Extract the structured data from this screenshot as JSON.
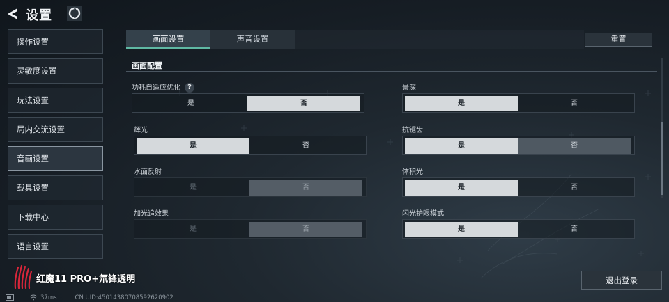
{
  "header": {
    "title": "设置",
    "back_icon": "back-arrow-icon",
    "logo_icon": "game-logo-icon"
  },
  "sidebar": {
    "items": [
      {
        "label": "操作设置",
        "active": false
      },
      {
        "label": "灵敏度设置",
        "active": false
      },
      {
        "label": "玩法设置",
        "active": false
      },
      {
        "label": "局内交流设置",
        "active": false
      },
      {
        "label": "音画设置",
        "active": true
      },
      {
        "label": "载具设置",
        "active": false
      },
      {
        "label": "下载中心",
        "active": false
      },
      {
        "label": "语言设置",
        "active": false
      }
    ]
  },
  "tabs": [
    {
      "label": "画面设置",
      "active": true
    },
    {
      "label": "声音设置",
      "active": false
    }
  ],
  "reset_label": "重置",
  "section": {
    "title": "画面配置",
    "options": [
      {
        "label": "功耗自适应优化",
        "help": "?",
        "yes": "是",
        "no": "否",
        "selected": "no",
        "disabled": false
      },
      {
        "label": "景深",
        "yes": "是",
        "no": "否",
        "selected": "yes",
        "disabled": false
      },
      {
        "label": "辉光",
        "yes": "是",
        "no": "否",
        "selected": "yes",
        "disabled": false
      },
      {
        "label": "抗锯齿",
        "yes": "是",
        "no": "否",
        "selected": "yes",
        "disabled": false
      },
      {
        "label": "水面反射",
        "yes": "是",
        "no": "否",
        "selected": "no",
        "disabled": true
      },
      {
        "label": "体积光",
        "yes": "是",
        "no": "否",
        "selected": "yes",
        "disabled": false
      },
      {
        "label": "加光追效果",
        "yes": "是",
        "no": "否",
        "selected": "no",
        "disabled": true
      },
      {
        "label": "闪光护眼模式",
        "yes": "是",
        "no": "否",
        "selected": "yes",
        "disabled": false
      }
    ]
  },
  "logout_label": "退出登录",
  "watermark": {
    "text": "红魔11 PRO+氘锋透明",
    "logo_icon": "red-magic-logo-icon"
  },
  "status": {
    "wifi_icon": "wifi-icon",
    "ping": "37ms",
    "uid": "CN UID:4501438070859262090​2"
  },
  "colors": {
    "accent": "#5fb8a3",
    "selected_segment": "#d5d9dc",
    "watermark_red": "#d8263a"
  }
}
